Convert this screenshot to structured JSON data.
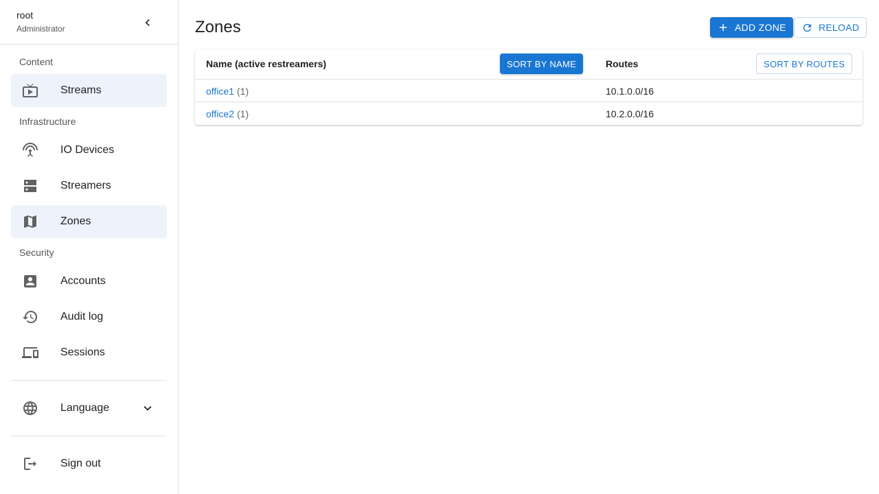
{
  "user": {
    "name": "root",
    "role": "Administrator"
  },
  "sidebar": {
    "sections": {
      "content": "Content",
      "infrastructure": "Infrastructure",
      "security": "Security"
    },
    "items": {
      "streams": "Streams",
      "io_devices": "IO Devices",
      "streamers": "Streamers",
      "zones": "Zones",
      "accounts": "Accounts",
      "audit_log": "Audit log",
      "sessions": "Sessions"
    },
    "active_items": [
      "Streams",
      "Zones"
    ],
    "language_label": "Language",
    "sign_out_label": "Sign out"
  },
  "page": {
    "title": "Zones",
    "add_button": "ADD ZONE",
    "reload_button": "RELOAD"
  },
  "table": {
    "col_name": "Name (active restreamers)",
    "col_routes": "Routes",
    "sort_by_name": "SORT BY NAME",
    "sort_by_routes": "SORT BY ROUTES",
    "rows": [
      {
        "name": "office1",
        "count": "(1)",
        "routes": "10.1.0.0/16"
      },
      {
        "name": "office2",
        "count": "(1)",
        "routes": "10.2.0.0/16"
      }
    ]
  },
  "colors": {
    "accent": "#1976d2",
    "active_bg": "#eef3fb",
    "icon": "#616161"
  },
  "icons": {
    "collapse": "chevron-left-icon",
    "streams": "tv-icon",
    "io_devices": "antenna-icon",
    "streamers": "server-icon",
    "zones": "map-icon",
    "accounts": "account-box-icon",
    "audit_log": "history-icon",
    "sessions": "devices-icon",
    "language": "globe-icon",
    "language_expand": "chevron-down-icon",
    "sign_out": "logout-icon",
    "add": "plus-icon",
    "reload": "refresh-icon"
  }
}
